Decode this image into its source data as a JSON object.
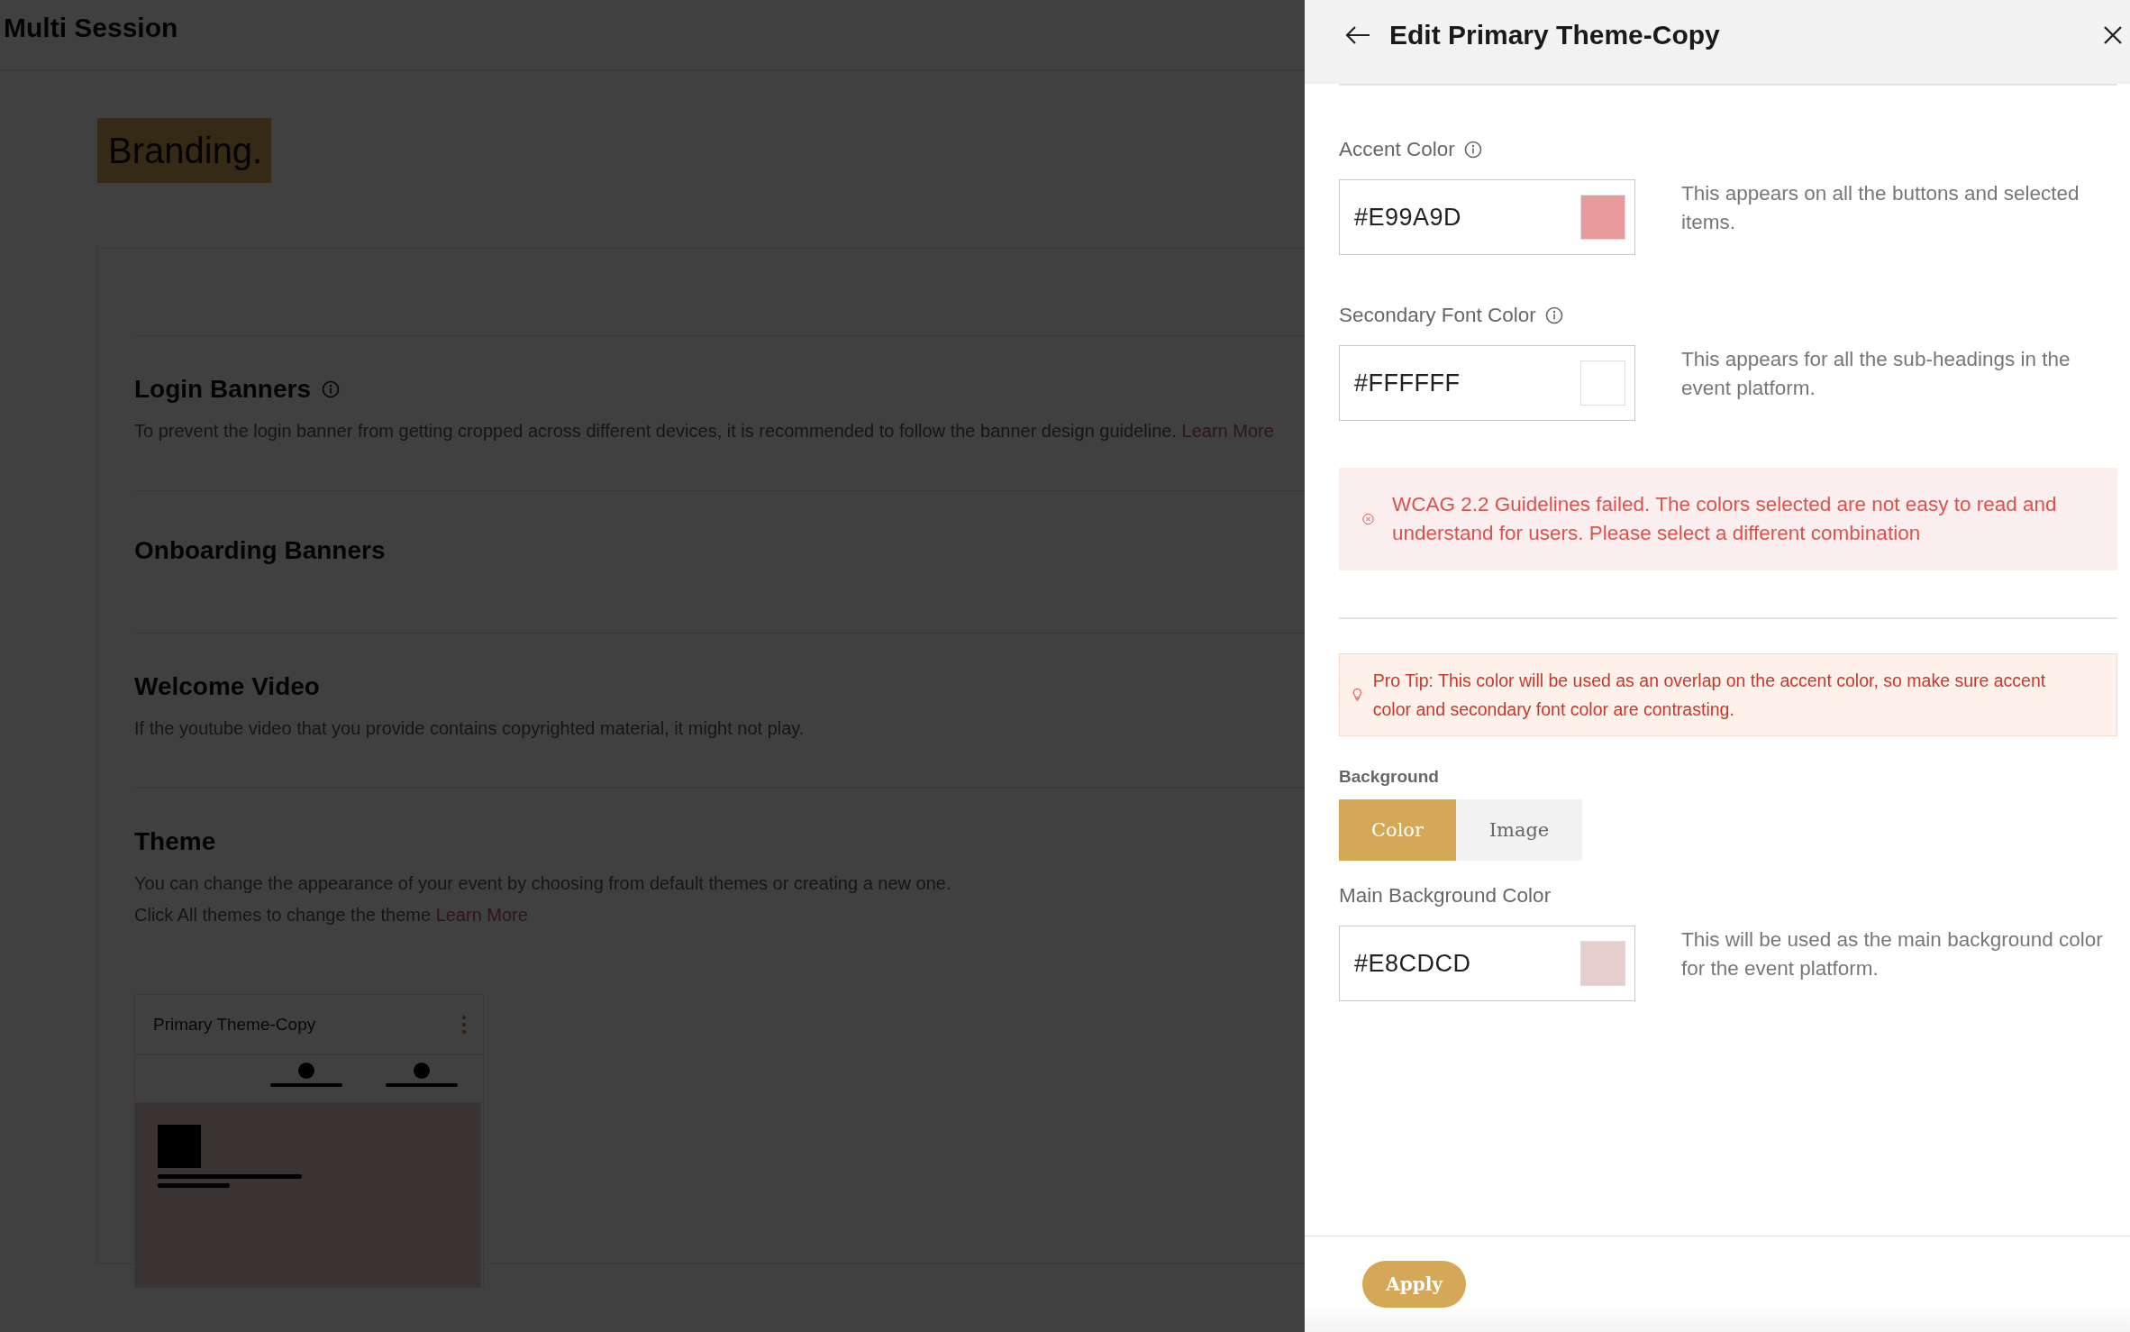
{
  "app_header": {
    "title": "Multi Session"
  },
  "page": {
    "heading": "Branding.",
    "sections": [
      {
        "title": "Login Banners",
        "info": true,
        "lines": [
          {
            "text": "To prevent the login banner from getting cropped across different devices, it is recommended to follow the banner design guideline.",
            "link": "Learn More"
          }
        ]
      },
      {
        "title": "Onboarding Banners",
        "info": false
      },
      {
        "title": "Welcome Video",
        "info": false,
        "lines": [
          {
            "text": "If the youtube video that you provide contains copyrighted material, it might not play."
          }
        ]
      },
      {
        "title": "Theme",
        "info": false,
        "lines": [
          {
            "text": "You can change the appearance of your event by choosing from default themes or creating a new one."
          },
          {
            "text": "Click All themes to change the theme",
            "link": "Learn More"
          }
        ],
        "theme_card": {
          "name": "Primary Theme-Copy"
        }
      }
    ]
  },
  "panel": {
    "title": "Edit Primary Theme-Copy",
    "fields": [
      {
        "label": "Accent Color",
        "info": true,
        "value": "#E99A9D",
        "hint": "This appears on all the buttons and selected items."
      },
      {
        "label": "Secondary Font Color",
        "info": true,
        "value": "#FFFFFF",
        "hint": "This appears for all the sub-headings in the event platform."
      }
    ],
    "error": "WCAG 2.2 Guidelines failed. The colors selected are not easy to read and understand for users. Please select a different combination",
    "tip": "Pro Tip: This color will be used as an overlap on the accent color, so make sure accent color and secondary font color are contrasting.",
    "background": {
      "label": "Background",
      "options": [
        {
          "label": "Color",
          "selected": true
        },
        {
          "label": "Image",
          "selected": false
        }
      ]
    },
    "main_field": {
      "label": "Main Background Color",
      "info": false,
      "value": "#E8CDCD",
      "hint": "This will be used as the main background color for the event platform."
    },
    "apply": "Apply"
  }
}
